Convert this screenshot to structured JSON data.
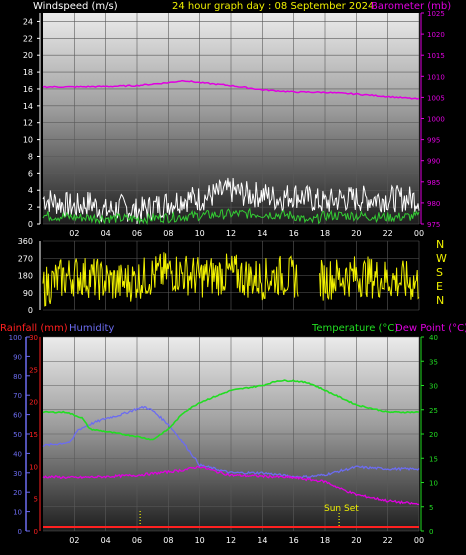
{
  "header": {
    "left_label": "Windspeed (m/s)",
    "title": "24 hour graph day : 08 September 2024",
    "right_label": "Barometer (mb)"
  },
  "colors": {
    "background": "#000000",
    "windspeed": "#ffffff",
    "wind_avg": "#33cc33",
    "barometer": "#e000e0",
    "wind_dir": "#f0f000",
    "humidity": "#6c6cf0",
    "rainfall": "#ff2020",
    "temperature": "#22dd22",
    "dew_point": "#e000e0",
    "sunset_marker": "#f0f000"
  },
  "direction_labels": [
    "N",
    "W",
    "S",
    "E",
    "N"
  ],
  "bottom_labels": {
    "rainfall": "Rainfall (mm)",
    "humidity": "Humidity",
    "temperature": "Temperature (°C)",
    "dew_point": "Dew Point (°C)",
    "sunset": "Sun Set"
  },
  "chart_data": [
    {
      "type": "line",
      "title": "24 hour graph day : 08 September 2024",
      "x_ticks": [
        "02",
        "04",
        "06",
        "08",
        "10",
        "12",
        "14",
        "16",
        "18",
        "20",
        "22",
        "00"
      ],
      "left_axis": {
        "label": "Windspeed (m/s)",
        "ticks": [
          0,
          2,
          4,
          6,
          8,
          10,
          12,
          14,
          16,
          18,
          20,
          22,
          24
        ],
        "ylim": [
          0,
          25
        ]
      },
      "right_axis": {
        "label": "Barometer (mb)",
        "ticks": [
          975,
          980,
          985,
          990,
          995,
          1000,
          1005,
          1010,
          1015,
          1020,
          1025
        ],
        "ylim": [
          975,
          1025
        ]
      },
      "series": [
        {
          "name": "Windspeed (m/s)",
          "axis": "left",
          "x": [
            0,
            1,
            2,
            3,
            4,
            5,
            6,
            7,
            8,
            9,
            10,
            11,
            12,
            13,
            14,
            15,
            16,
            17,
            18,
            19,
            20,
            21,
            22,
            23,
            24
          ],
          "y": [
            3,
            2.5,
            2,
            2.5,
            1.5,
            2,
            1.5,
            2,
            2.5,
            3,
            3,
            3.5,
            4,
            3.5,
            3.5,
            3,
            3.5,
            3,
            2.5,
            3,
            3,
            3,
            3,
            3,
            3
          ]
        },
        {
          "x": [
            0,
            2,
            4,
            6,
            8,
            10,
            12,
            14,
            16,
            17,
            18,
            20,
            22,
            24
          ],
          "y": [
            1,
            0.8,
            0.7,
            0.6,
            0.8,
            1,
            1.2,
            1.2,
            1,
            0.2,
            1,
            1,
            0.8,
            0.9
          ],
          "axis": "left"
        },
        {
          "name": "Barometer (mb)",
          "axis": "right",
          "x": [
            0,
            2,
            4,
            6,
            8,
            9,
            10,
            12,
            14,
            16,
            18,
            20,
            22,
            24
          ],
          "y": [
            1007.5,
            1007.5,
            1007.6,
            1007.8,
            1008.5,
            1009,
            1008.5,
            1007.8,
            1006.8,
            1006.3,
            1006.2,
            1005.8,
            1005.2,
            1004.6
          ]
        }
      ]
    },
    {
      "type": "scatter",
      "left_axis": {
        "ticks": [
          0,
          90,
          180,
          270,
          360
        ],
        "ylim": [
          0,
          360
        ]
      },
      "right_axis": {
        "labels": [
          "N",
          "W",
          "S",
          "E",
          "N"
        ]
      },
      "series": [
        {
          "x": [
            0,
            1,
            2,
            3,
            4,
            5,
            6,
            7,
            8,
            9,
            10,
            11,
            12,
            13,
            14,
            15,
            16,
            17,
            18,
            19,
            20,
            21,
            22,
            23,
            24
          ],
          "y": [
            120,
            160,
            180,
            170,
            150,
            140,
            160,
            180,
            200,
            190,
            170,
            180,
            190,
            170,
            160,
            180,
            170,
            150,
            160,
            170,
            180,
            170,
            160,
            150,
            140
          ]
        }
      ]
    },
    {
      "type": "line",
      "x_ticks": [
        "02",
        "04",
        "06",
        "08",
        "10",
        "12",
        "14",
        "16",
        "18",
        "20",
        "22",
        "00"
      ],
      "left_axis_humidity": {
        "label": "Humidity",
        "ticks": [
          0,
          10,
          20,
          30,
          40,
          50,
          60,
          70,
          80,
          90,
          100
        ],
        "ylim": [
          0,
          100
        ]
      },
      "left_axis_rain": {
        "label": "Rainfall (mm)",
        "ticks": [
          0,
          5,
          10,
          15,
          20,
          25,
          30
        ],
        "ylim": [
          0,
          30
        ]
      },
      "right_axis": {
        "label": "Temperature (°C)",
        "ticks": [
          0,
          5,
          10,
          15,
          20,
          25,
          30,
          35,
          40
        ],
        "ylim": [
          0,
          40
        ]
      },
      "annotations": [
        "Sun Set"
      ],
      "series": [
        {
          "name": "Humidity",
          "axis": "humidity",
          "x": [
            0,
            1,
            1.8,
            2.2,
            3,
            4,
            5,
            6,
            6.5,
            7,
            8,
            9,
            10,
            12,
            14,
            16,
            17,
            18,
            19,
            20,
            22,
            24
          ],
          "y": [
            44,
            45,
            46,
            52,
            55,
            58,
            60,
            63,
            64,
            62,
            55,
            45,
            34,
            30,
            30,
            28,
            28,
            29,
            31,
            33,
            32,
            32
          ]
        },
        {
          "name": "Rainfall (mm)",
          "axis": "rain",
          "x": [
            0,
            24
          ],
          "y": [
            0,
            0
          ]
        },
        {
          "name": "Temperature (°C)",
          "axis": "temp",
          "x": [
            0,
            1.5,
            2.5,
            3,
            5,
            6,
            7,
            8,
            9,
            10,
            12,
            14,
            15,
            16,
            17,
            18,
            19,
            20,
            22,
            24
          ],
          "y": [
            24.5,
            24.5,
            23.3,
            21,
            20,
            19.5,
            18.8,
            21,
            24.5,
            26.5,
            29,
            30,
            31,
            31,
            30.5,
            29,
            27.5,
            26,
            24.5,
            24.5
          ]
        },
        {
          "name": "Dew Point (°C)",
          "axis": "temp",
          "x": [
            0,
            2,
            4,
            6,
            8,
            9,
            10,
            11,
            12,
            14,
            16,
            18,
            19,
            20,
            22,
            24
          ],
          "y": [
            11.2,
            11,
            11.2,
            11.5,
            12.2,
            12.6,
            13.3,
            12.3,
            11.5,
            11.3,
            11,
            10.2,
            8.7,
            7.5,
            6.2,
            5.5
          ]
        }
      ]
    }
  ]
}
